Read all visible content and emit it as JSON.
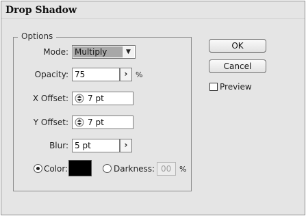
{
  "dialog": {
    "title": "Drop Shadow"
  },
  "options": {
    "legend": "Options",
    "mode_label": "Mode:",
    "mode_value": "Multiply",
    "opacity_label": "Opacity:",
    "opacity_value": "75",
    "opacity_unit": "%",
    "x_offset_label": "X Offset:",
    "x_offset_value": "7 pt",
    "y_offset_label": "Y Offset:",
    "y_offset_value": "7 pt",
    "blur_label": "Blur:",
    "blur_value": "5 pt",
    "color_label": "Color:",
    "color_selected": true,
    "color_swatch": "#000000",
    "darkness_label": "Darkness:",
    "darkness_value": "00",
    "darkness_unit": "%"
  },
  "buttons": {
    "ok": "OK",
    "cancel": "Cancel"
  },
  "preview": {
    "label": "Preview",
    "checked": false
  },
  "icons": {
    "dropdown": "chevron-down-icon",
    "arrow": "arrow-right-icon",
    "spinner": "spinner-icon"
  }
}
